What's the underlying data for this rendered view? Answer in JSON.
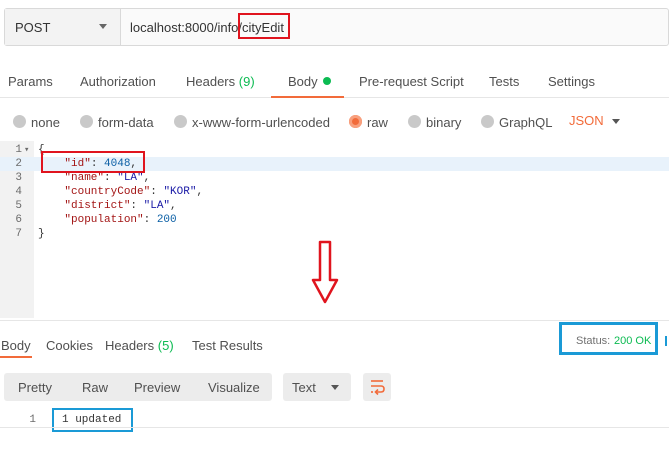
{
  "request": {
    "method": "POST",
    "url": "localhost:8000/info/cityEdit"
  },
  "request_tabs": [
    {
      "label": "Params"
    },
    {
      "label": "Authorization"
    },
    {
      "label": "Headers",
      "count": "(9)"
    },
    {
      "label": "Body"
    },
    {
      "label": "Pre-request Script"
    },
    {
      "label": "Tests"
    },
    {
      "label": "Settings"
    }
  ],
  "body_types": [
    "none",
    "form-data",
    "x-www-form-urlencoded",
    "raw",
    "binary",
    "GraphQL"
  ],
  "body_type_selected": "raw",
  "body_format": "JSON",
  "editor": {
    "line_numbers": [
      "1",
      "2",
      "3",
      "4",
      "5",
      "6",
      "7"
    ],
    "lines": [
      "{",
      "    \"id\": 4048,",
      "    \"name\": \"LA\",",
      "    \"countryCode\": \"KOR\",",
      "    \"district\": \"LA\",",
      "    \"population\": 200",
      "}"
    ]
  },
  "response": {
    "tabs": [
      {
        "label": "Body"
      },
      {
        "label": "Cookies"
      },
      {
        "label": "Headers",
        "count": "(5)"
      },
      {
        "label": "Test Results"
      }
    ],
    "status_label": "Status:",
    "status_value": "200 OK",
    "format_buttons": [
      "Pretty",
      "Raw",
      "Preview",
      "Visualize"
    ],
    "format_select": "Text",
    "output_line_number": "1",
    "output_text": "1 updated"
  },
  "colors": {
    "accent": "#f26b3a",
    "success": "#0cbb52",
    "highlight_red": "#e0141e",
    "highlight_blue": "#1a9ad6"
  },
  "icons": [
    "chevron-down-icon",
    "fold-arrow-icon",
    "down-arrow-icon",
    "wrap-lines-icon"
  ]
}
